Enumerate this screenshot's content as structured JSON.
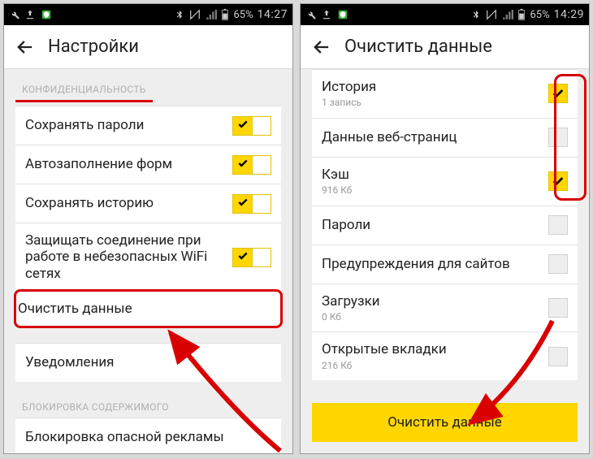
{
  "statusbar": {
    "battery": "65%",
    "time": "14:27",
    "time2": "14:29"
  },
  "left": {
    "title": "Настройки",
    "section_privacy": "КОНФИДЕНЦИАЛЬНОСТЬ",
    "items": [
      {
        "label": "Сохранять пароли"
      },
      {
        "label": "Автозаполнение форм"
      },
      {
        "label": "Сохранять историю"
      },
      {
        "label": "Защищать соединение при работе в небезопасных WiFi сетях"
      }
    ],
    "clear_data": "Очистить данные",
    "notifications": "Уведомления",
    "section_block": "БЛОКИРОВКА СОДЕРЖИМОГО",
    "block_ads": "Блокировка опасной рекламы"
  },
  "right": {
    "title": "Очистить данные",
    "items": [
      {
        "label": "История",
        "sub": "1 запись",
        "checked": true
      },
      {
        "label": "Данные веб-страниц",
        "sub": "",
        "checked": false
      },
      {
        "label": "Кэш",
        "sub": "916 Кб",
        "checked": true
      },
      {
        "label": "Пароли",
        "sub": "",
        "checked": false
      },
      {
        "label": "Предупреждения для сайтов",
        "sub": "",
        "checked": false
      },
      {
        "label": "Загрузки",
        "sub": "0 Кб",
        "checked": false
      },
      {
        "label": "Открытые вкладки",
        "sub": "216 Кб",
        "checked": false
      }
    ],
    "button": "Очистить данные"
  }
}
